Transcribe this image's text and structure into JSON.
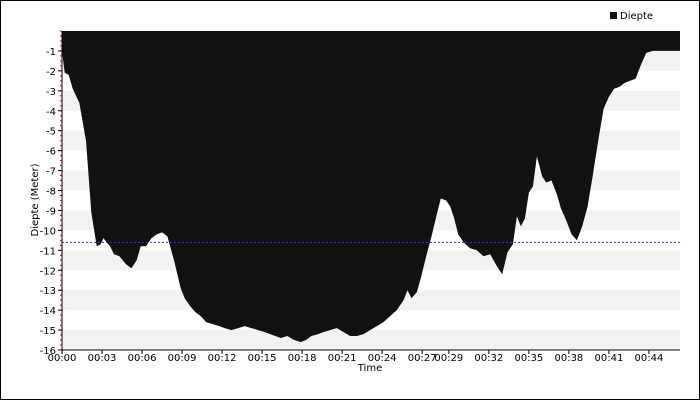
{
  "chart_data": {
    "type": "area",
    "title": "",
    "xlabel": "Time",
    "ylabel": "Diepte (Meter)",
    "legend": {
      "position": "top-right",
      "entries": [
        "Diepte"
      ]
    },
    "xlim": [
      0,
      46.33
    ],
    "ylim": [
      -16,
      0
    ],
    "xticks": [
      "00:00",
      "00:03",
      "00:06",
      "00:09",
      "00:12",
      "00:15",
      "00:18",
      "00:21",
      "00:24",
      "00:27",
      "00:29",
      "00:32",
      "00:35",
      "00:38",
      "00:41",
      "00:44"
    ],
    "xtick_minutes": [
      0,
      3,
      6,
      9,
      12,
      15,
      18,
      21,
      24,
      27,
      29,
      32,
      35,
      38,
      41,
      44
    ],
    "yticks": [
      -1,
      -2,
      -3,
      -4,
      -5,
      -6,
      -7,
      -8,
      -9,
      -10,
      -11,
      -12,
      -13,
      -14,
      -15,
      -16
    ],
    "reference_line": {
      "value": -10.6,
      "color": "#3333ff",
      "style": "dashed"
    },
    "grid": {
      "horizontal_bands": true,
      "band_color": "#f2f2f2"
    },
    "series": [
      {
        "name": "Diepte",
        "color": "#111111",
        "x": [
          0,
          0.2,
          0.5,
          0.8,
          1.3,
          1.8,
          2.2,
          2.6,
          2.9,
          3.1,
          3.6,
          3.9,
          4.3,
          4.8,
          5.2,
          5.6,
          5.9,
          6.3,
          6.7,
          7.1,
          7.5,
          7.9,
          8.4,
          8.9,
          9.2,
          9.6,
          10,
          10.4,
          10.8,
          11.3,
          11.8,
          12.2,
          12.7,
          13.2,
          13.7,
          14.2,
          14.7,
          15.2,
          15.6,
          16,
          16.4,
          16.9,
          17.4,
          17.9,
          18.3,
          18.7,
          19.2,
          19.6,
          20.1,
          20.6,
          21.1,
          21.6,
          22.1,
          22.6,
          23.1,
          23.6,
          24.1,
          24.6,
          25.1,
          25.6,
          25.9,
          26.2,
          26.6,
          26.9,
          27.3,
          27.7,
          28.1,
          28.4,
          28.8,
          29.1,
          29.4,
          29.7,
          30.1,
          30.6,
          31.1,
          31.6,
          32.1,
          32.6,
          33,
          33.4,
          33.8,
          34.1,
          34.4,
          34.7,
          35,
          35.3,
          35.6,
          36,
          36.3,
          36.7,
          37.1,
          37.4,
          37.8,
          38.2,
          38.6,
          39,
          39.4,
          39.8,
          40.2,
          40.6,
          41,
          41.4,
          41.8,
          42.2,
          42.6,
          43,
          43.4,
          43.8,
          44.3,
          44.8,
          45.2,
          45.7,
          46.33
        ],
        "y": [
          -1.0,
          -2.1,
          -2.2,
          -2.9,
          -3.6,
          -5.5,
          -9.1,
          -10.8,
          -10.7,
          -10.4,
          -10.8,
          -11.2,
          -11.3,
          -11.7,
          -11.9,
          -11.5,
          -10.8,
          -10.8,
          -10.4,
          -10.2,
          -10.1,
          -10.3,
          -11.5,
          -12.9,
          -13.4,
          -13.8,
          -14.1,
          -14.3,
          -14.6,
          -14.7,
          -14.8,
          -14.9,
          -15.0,
          -14.9,
          -14.8,
          -14.9,
          -15.0,
          -15.1,
          -15.2,
          -15.3,
          -15.4,
          -15.3,
          -15.5,
          -15.6,
          -15.5,
          -15.3,
          -15.2,
          -15.1,
          -15.0,
          -14.9,
          -15.1,
          -15.3,
          -15.3,
          -15.2,
          -15.0,
          -14.8,
          -14.6,
          -14.3,
          -14.0,
          -13.5,
          -13.0,
          -13.4,
          -13.1,
          -12.4,
          -11.3,
          -10.3,
          -9.2,
          -8.4,
          -8.5,
          -8.8,
          -9.4,
          -10.2,
          -10.6,
          -10.9,
          -11.0,
          -11.3,
          -11.2,
          -11.8,
          -12.2,
          -11.1,
          -10.7,
          -9.3,
          -9.8,
          -9.4,
          -8.1,
          -7.8,
          -6.3,
          -7.3,
          -7.6,
          -7.5,
          -8.2,
          -8.9,
          -9.5,
          -10.2,
          -10.5,
          -9.8,
          -8.8,
          -7.2,
          -5.5,
          -3.9,
          -3.3,
          -2.9,
          -2.8,
          -2.6,
          -2.5,
          -2.4,
          -1.7,
          -1.1,
          -1.0,
          -1.0,
          -1.0,
          -1.0,
          -1.0
        ]
      }
    ]
  }
}
